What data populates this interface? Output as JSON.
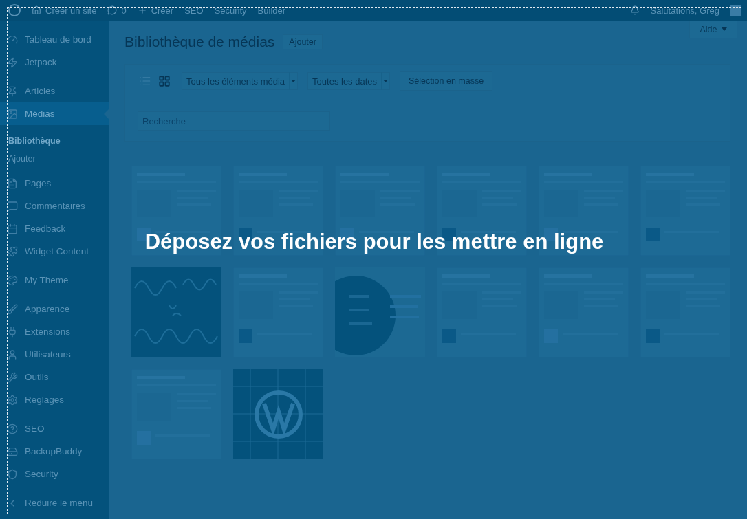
{
  "admin_bar": {
    "items": [
      {
        "label": "Créer un site"
      },
      {
        "label": "0"
      },
      {
        "label": "Créer"
      },
      {
        "label": "SEO"
      },
      {
        "label": "Security"
      },
      {
        "label": "Builder"
      }
    ],
    "greeting": "Salutations, Greg"
  },
  "sidebar": {
    "groups": [
      {
        "items": [
          {
            "label": "Tableau de bord",
            "selected": false
          },
          {
            "label": "Jetpack",
            "selected": false
          }
        ]
      },
      {
        "items": [
          {
            "label": "Articles",
            "selected": false
          },
          {
            "label": "Médias",
            "selected": true,
            "children": [
              {
                "label": "Bibliothèque",
                "selected": true
              },
              {
                "label": "Ajouter",
                "selected": false
              }
            ]
          },
          {
            "label": "Pages",
            "selected": false
          },
          {
            "label": "Commentaires",
            "selected": false
          },
          {
            "label": "Feedback",
            "selected": false
          },
          {
            "label": "Widget Content",
            "selected": false
          }
        ]
      },
      {
        "items": [
          {
            "label": "My Theme",
            "selected": false
          }
        ]
      },
      {
        "items": [
          {
            "label": "Apparence",
            "selected": false
          },
          {
            "label": "Extensions",
            "selected": false
          },
          {
            "label": "Utilisateurs",
            "selected": false
          },
          {
            "label": "Outils",
            "selected": false
          },
          {
            "label": "Réglages",
            "selected": false
          }
        ]
      },
      {
        "items": [
          {
            "label": "SEO",
            "selected": false
          },
          {
            "label": "BackupBuddy",
            "selected": false
          },
          {
            "label": "Security",
            "selected": false
          }
        ]
      },
      {
        "items": [
          {
            "label": "Réduire le menu",
            "selected": false
          }
        ]
      }
    ]
  },
  "help_tab": {
    "label": "Aide"
  },
  "page": {
    "title": "Bibliothèque de médias",
    "add_button": "Ajouter"
  },
  "toolbar": {
    "view_modes": [
      {
        "kind": "list",
        "selected": false
      },
      {
        "kind": "grid",
        "selected": true
      }
    ],
    "filters": [
      {
        "value": "Tous les éléments média"
      },
      {
        "value": "Toutes les dates"
      }
    ],
    "bulk_button": "Sélection en masse",
    "search": {
      "placeholder": "Recherche"
    }
  },
  "drop_overlay": {
    "message": "Déposez vos fichiers pour les mettre en ligne"
  }
}
